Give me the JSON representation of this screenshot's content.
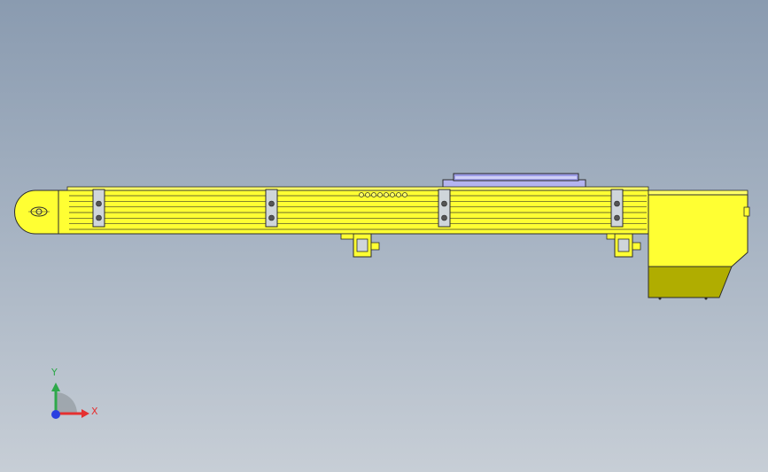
{
  "viewport": {
    "background_top": "#8a9bb0",
    "background_bottom": "#c7ced6"
  },
  "model": {
    "body_color": "#ffff33",
    "body_shadow_color": "#b0ad00",
    "bracket_color": "#cfd5da",
    "carriage_color": "#b4b4f0",
    "outline_color": "#2c2c2c",
    "bracket_count": 4,
    "belt_line_count": 7
  },
  "triad": {
    "y_label": "Y",
    "x_label": "X",
    "y_color": "#2ea84a",
    "x_color": "#e53030",
    "z_color": "#2b3fe0"
  }
}
